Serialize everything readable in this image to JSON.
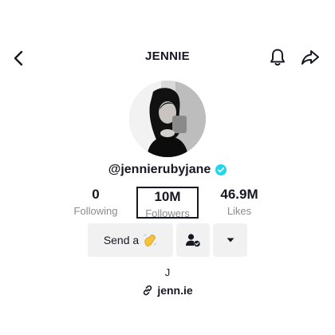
{
  "header": {
    "title": "JENNIE",
    "icons": {
      "back": "back-arrow-icon",
      "bell": "bell-icon",
      "share": "share-icon"
    }
  },
  "profile": {
    "handle": "@jennierubyjane",
    "verified": true,
    "verified_color": "#20d5ec"
  },
  "stats": [
    {
      "value": "0",
      "label": "Following"
    },
    {
      "value": "10M",
      "label": "Followers"
    },
    {
      "value": "46.9M",
      "label": "Likes"
    }
  ],
  "actions": {
    "send_label": "Send a",
    "send_icon": "waving-hand-icon",
    "friends_icon": "add-friend-icon",
    "more_icon": "caret-down-icon"
  },
  "bio": "J",
  "link": {
    "text": "jenn.ie",
    "icon": "link-icon"
  }
}
